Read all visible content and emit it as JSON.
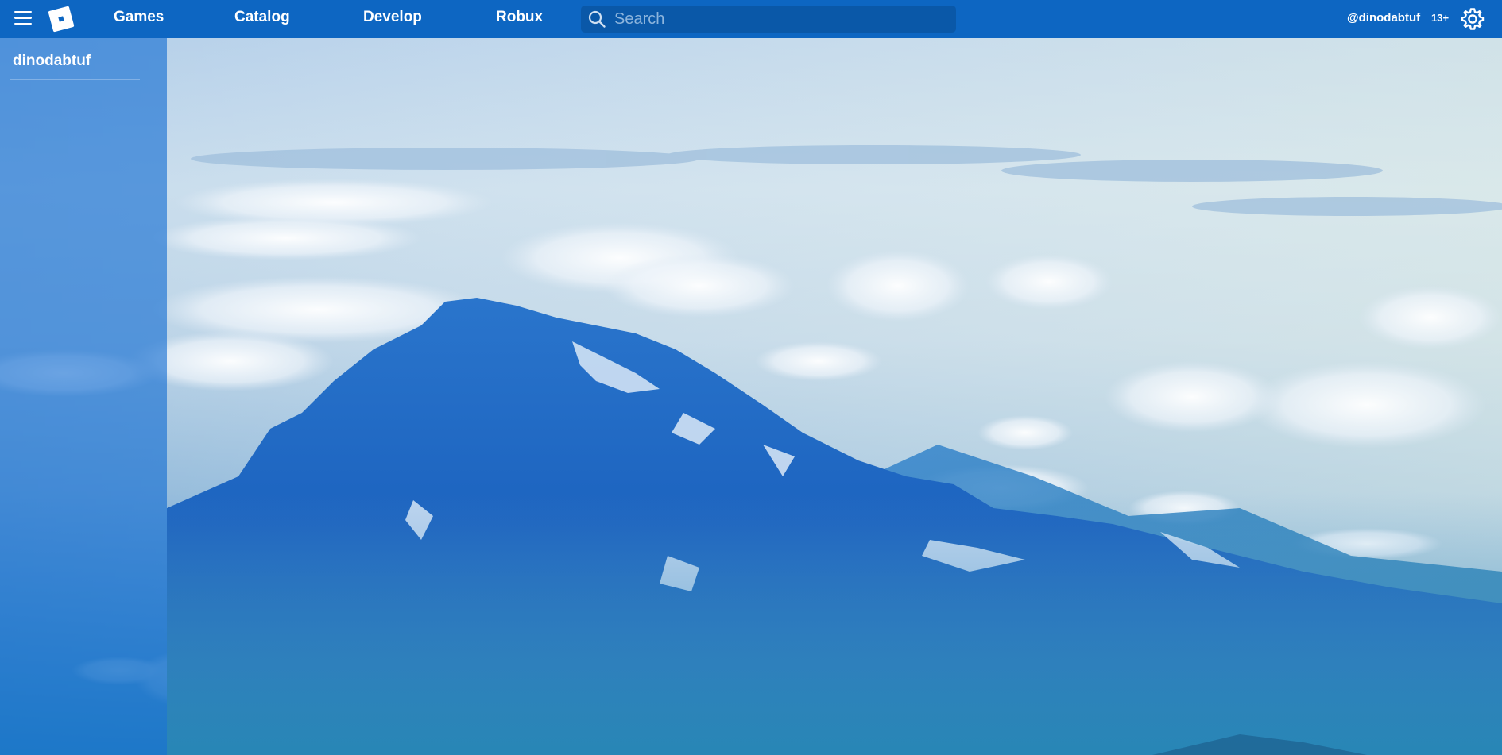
{
  "header": {
    "nav": {
      "games": "Games",
      "catalog": "Catalog",
      "develop": "Develop",
      "robux": "Robux"
    },
    "search": {
      "placeholder": "Search",
      "value": ""
    },
    "user_handle": "@dinodabtuf",
    "age_badge": "13+",
    "icons": {
      "menu": "hamburger-menu-icon",
      "logo": "roblox-logo",
      "search": "search-icon",
      "settings": "gear-icon"
    }
  },
  "sidebar": {
    "username": "dinodabtuf"
  },
  "colors": {
    "topbar": "#0d66c2",
    "search_bg": "#0a58a8",
    "sidebar_overlay": "#126cd2"
  }
}
